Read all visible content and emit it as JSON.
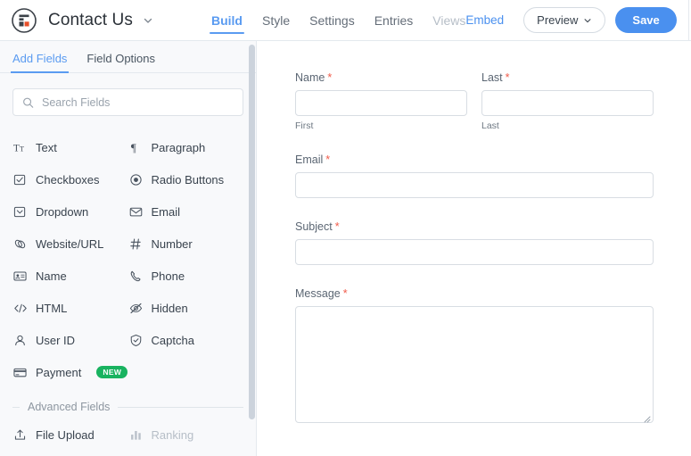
{
  "header": {
    "logo_icon": "wpforms-logo-icon",
    "form_title": "Contact Us",
    "title_caret_icon": "chevron-down-icon",
    "tabs": [
      {
        "label": "Build",
        "state": "active"
      },
      {
        "label": "Style",
        "state": "default"
      },
      {
        "label": "Settings",
        "state": "default"
      },
      {
        "label": "Entries",
        "state": "default"
      },
      {
        "label": "Views",
        "state": "disabled"
      }
    ],
    "embed_label": "Embed",
    "preview_label": "Preview",
    "preview_caret_icon": "chevron-down-icon",
    "save_label": "Save",
    "close_icon": "close-icon"
  },
  "sidebar": {
    "tabs": [
      {
        "label": "Add Fields",
        "state": "active"
      },
      {
        "label": "Field Options",
        "state": "default"
      }
    ],
    "search": {
      "placeholder": "Search Fields",
      "value": "",
      "icon": "search-icon"
    },
    "standard_fields": [
      {
        "label": "Text",
        "icon": "text-icon",
        "disabled": false
      },
      {
        "label": "Paragraph",
        "icon": "paragraph-icon",
        "disabled": false
      },
      {
        "label": "Checkboxes",
        "icon": "checkbox-icon",
        "disabled": false
      },
      {
        "label": "Radio Buttons",
        "icon": "radio-icon",
        "disabled": false
      },
      {
        "label": "Dropdown",
        "icon": "dropdown-icon",
        "disabled": false
      },
      {
        "label": "Email",
        "icon": "envelope-icon",
        "disabled": false
      },
      {
        "label": "Website/URL",
        "icon": "link-icon",
        "disabled": false
      },
      {
        "label": "Number",
        "icon": "hash-icon",
        "disabled": false
      },
      {
        "label": "Name",
        "icon": "id-card-icon",
        "disabled": false
      },
      {
        "label": "Phone",
        "icon": "phone-icon",
        "disabled": false
      },
      {
        "label": "HTML",
        "icon": "code-icon",
        "disabled": false
      },
      {
        "label": "Hidden",
        "icon": "eye-slash-icon",
        "disabled": false
      },
      {
        "label": "User ID",
        "icon": "user-icon",
        "disabled": false
      },
      {
        "label": "Captcha",
        "icon": "shield-check-icon",
        "disabled": false
      },
      {
        "label": "Payment",
        "icon": "credit-card-icon",
        "disabled": false,
        "badge": "NEW"
      }
    ],
    "advanced_label": "Advanced Fields",
    "advanced_fields": [
      {
        "label": "File Upload",
        "icon": "upload-icon",
        "disabled": false
      },
      {
        "label": "Ranking",
        "icon": "ranking-icon",
        "disabled": true
      }
    ]
  },
  "form_preview": {
    "fields": [
      {
        "type": "name",
        "label": "Name",
        "required": true,
        "second_label": "Last",
        "second_required": true,
        "sub_first": "First",
        "sub_last": "Last",
        "value_first": "",
        "value_last": ""
      },
      {
        "type": "text",
        "label": "Email",
        "required": true,
        "value": ""
      },
      {
        "type": "text",
        "label": "Subject",
        "required": true,
        "value": ""
      },
      {
        "type": "textarea",
        "label": "Message",
        "required": true,
        "value": ""
      }
    ],
    "required_marker": "*"
  },
  "colors": {
    "accent_blue": "#4a90ef",
    "tab_blue": "#5a9bf1",
    "badge_green": "#19b360",
    "required_red": "#f05b4a",
    "logo_orange": "#e8502a",
    "sidebar_bg": "#f8f9fb",
    "border": "#e4e9ee"
  }
}
